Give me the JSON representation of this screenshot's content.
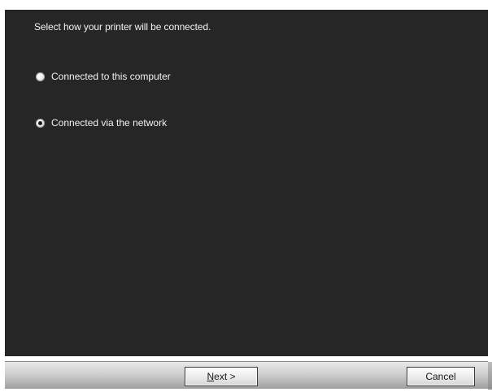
{
  "dialog": {
    "prompt": "Select how your printer will be connected.",
    "options": [
      {
        "label": "Connected to this computer",
        "selected": false
      },
      {
        "label": "Connected via the network",
        "selected": true
      }
    ]
  },
  "buttons": {
    "next_mnemonic": "N",
    "next_rest": "ext >",
    "cancel_label": "Cancel"
  },
  "colors": {
    "panel_background": "#262626",
    "text": "#f2f2f2"
  }
}
